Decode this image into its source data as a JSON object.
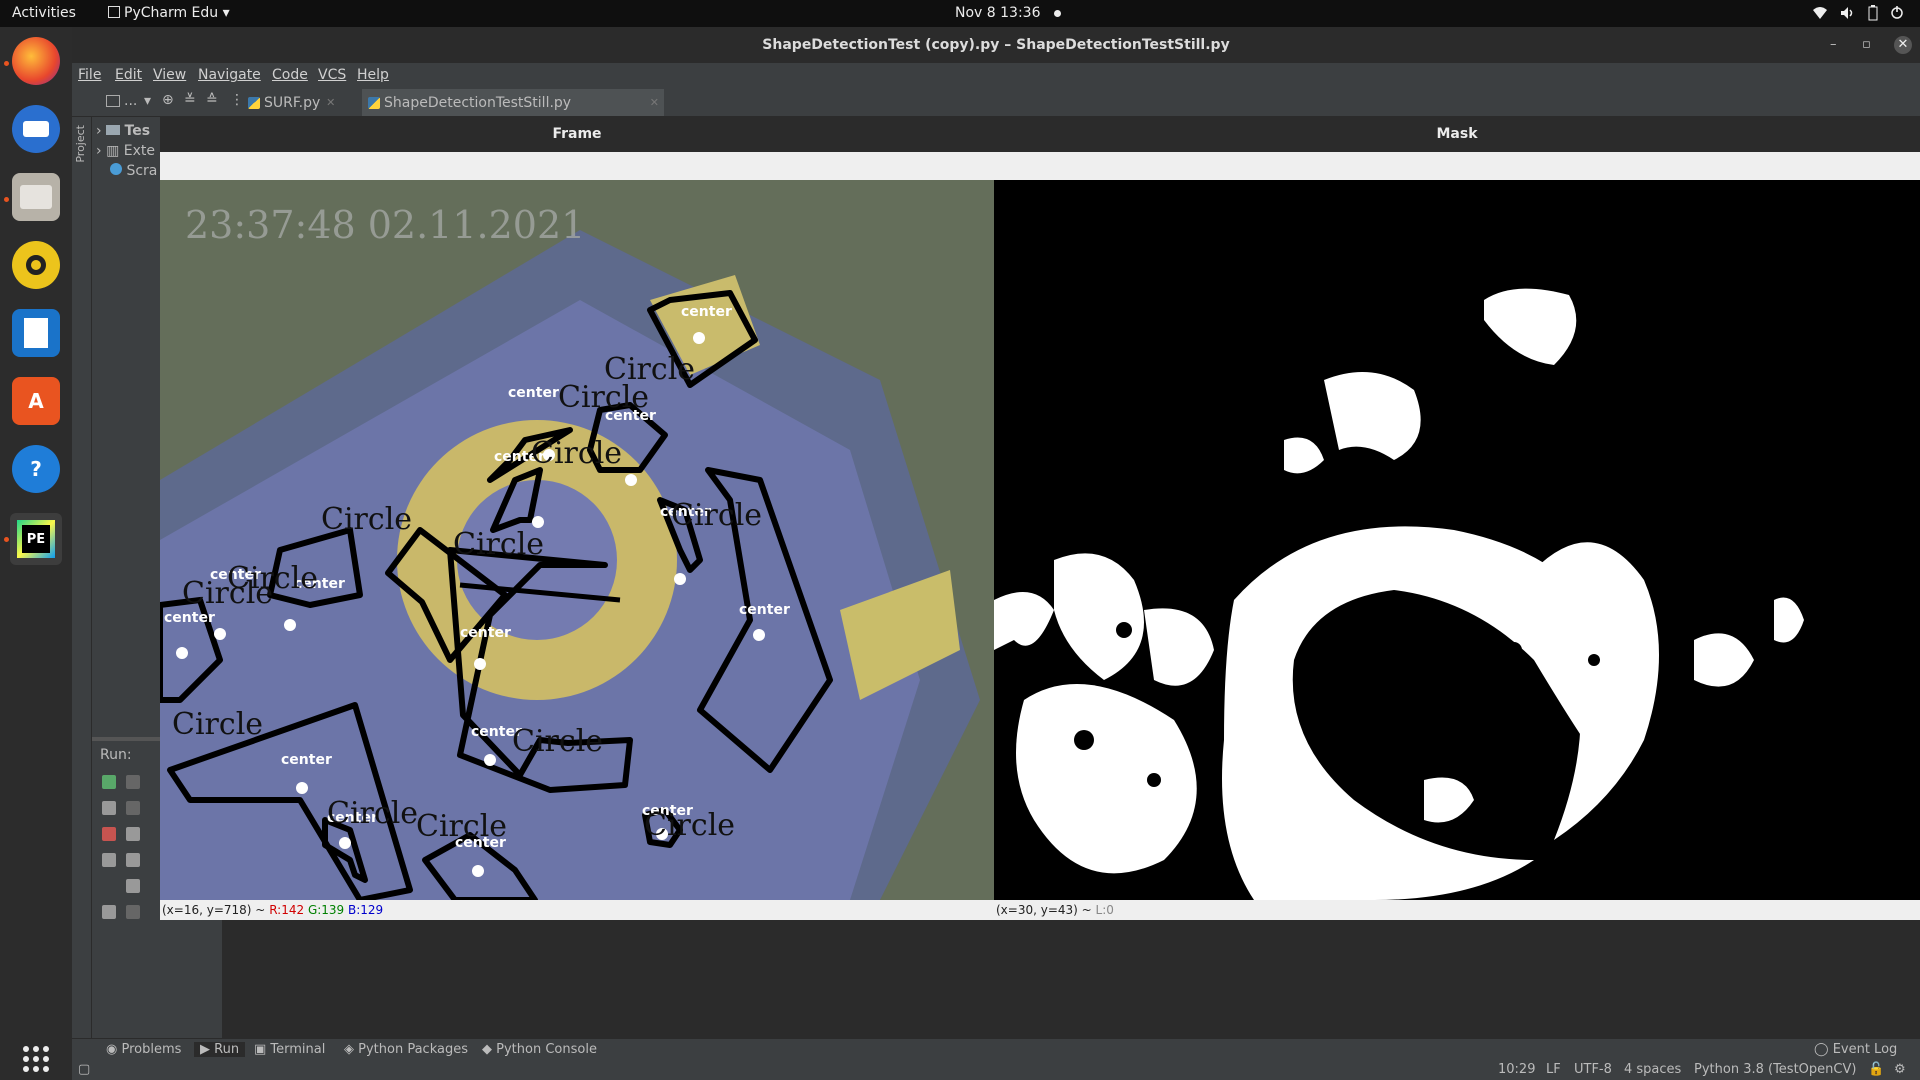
{
  "topbar": {
    "activities": "Activities",
    "app_name": "PyCharm Edu",
    "clock": "Nov 8  13:36"
  },
  "window": {
    "title": "ShapeDetectionTest (copy).py – ShapeDetectionTestStill.py"
  },
  "menu": [
    "File",
    "Edit",
    "View",
    "Navigate",
    "Code",
    "VCS",
    "Help"
  ],
  "toolbar": {
    "project_selector": "...",
    "tabs": [
      {
        "label": "SURF.py",
        "active": false
      },
      {
        "label": "ShapeDetectionTestStill.py",
        "active": true
      }
    ]
  },
  "project_panel": {
    "side_label": "Project",
    "items": [
      "Tes",
      "Exte",
      "Scra"
    ]
  },
  "run_panel": {
    "label": "Run:"
  },
  "frame_window": {
    "title": "Frame",
    "timestamp_overlay": "23:37:48 02.11.2021",
    "status": {
      "coords": "(x=16, y=718) ~",
      "r": "R:142",
      "g": "G:139",
      "b": "B:129"
    },
    "center_label": "center",
    "circle_label": "Circle"
  },
  "mask_window": {
    "title": "Mask",
    "status": {
      "coords": "(x=30, y=43) ~",
      "l": "L:0"
    }
  },
  "bottom_tools": [
    "Problems",
    "Run",
    "Terminal",
    "Python Packages",
    "Python Console",
    "Event Log"
  ],
  "status_bar": {
    "position": "10:29",
    "line_sep": "LF",
    "encoding": "UTF-8",
    "indent": "4 spaces",
    "interpreter": "Python 3.8 (TestOpenCV)"
  },
  "colors": {
    "accent": "#e95420",
    "red_channel": "#d00000",
    "green_channel": "#008000",
    "blue_channel": "#0000cc"
  }
}
